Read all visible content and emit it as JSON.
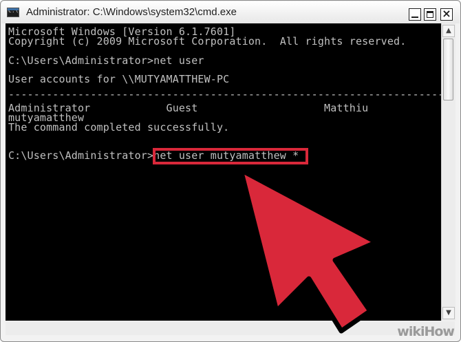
{
  "window": {
    "title": "Administrator: C:\\Windows\\system32\\cmd.exe",
    "controls": [
      "minimize",
      "maximize",
      "close"
    ]
  },
  "console": {
    "lines": [
      "Microsoft Windows [Version 6.1.7601]",
      "Copyright (c) 2009 Microsoft Corporation.  All rights reserved.",
      "",
      "C:\\Users\\Administrator>net user",
      "",
      "User accounts for \\\\MUTYAMATTHEW-PC",
      "",
      "-------------------------------------------------------------------------------",
      "Administrator            Guest                    Matthiu",
      "mutyamatthew",
      "The command completed successfully.",
      "",
      "",
      "C:\\Users\\Administrator>net user mutyamatthew *"
    ],
    "highlighted_command": "net user mutyamatthew *"
  },
  "colors": {
    "console_background": "#000000",
    "console_text": "#c0c0c0",
    "highlight": "#d9283a"
  },
  "icons": {
    "app": "cmd-icon",
    "annotation": "red-arrow"
  },
  "watermark": "wikiHow"
}
